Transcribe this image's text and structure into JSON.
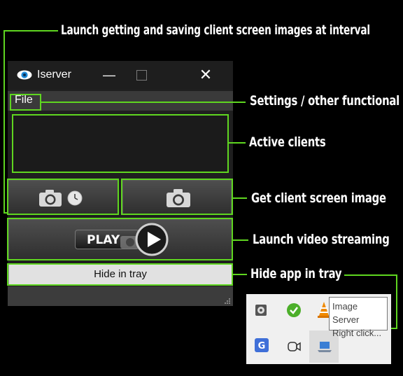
{
  "window": {
    "title": "Iserver",
    "minimize_glyph": "—",
    "close_glyph": "✕",
    "menu": {
      "file_label": "File"
    },
    "buttons": {
      "play_label": "PLAY",
      "hide_label": "Hide in tray"
    }
  },
  "annotations": {
    "interval_capture": "Launch getting and saving client screen images at interval",
    "menu": "Settings / other functional",
    "clients": "Active clients",
    "capture": "Get client screen image",
    "video": "Launch video streaming",
    "tray": "Hide app in tray"
  },
  "tray": {
    "tooltip_line1": "Image Server",
    "tooltip_line2": "Right click...",
    "icons": [
      "settings-gear-icon",
      "shield-check-icon",
      "vlc-cone-icon",
      "g-app-icon",
      "video-camera-icon",
      "laptop-icon"
    ]
  },
  "colors": {
    "highlight": "#5fd620",
    "background": "#000000",
    "window": "#1f1f1f"
  }
}
